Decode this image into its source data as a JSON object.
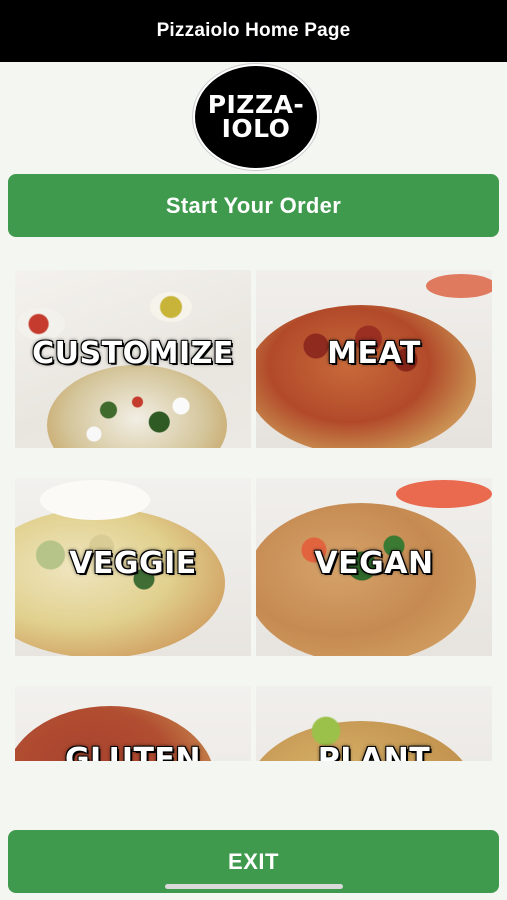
{
  "header": {
    "title": "Pizzaiolo Home Page"
  },
  "logo": {
    "line1": "PIZZA-",
    "line2": "IOLO"
  },
  "start_button": {
    "label": "Start Your Order"
  },
  "categories": [
    {
      "label": "CUSTOMIZE"
    },
    {
      "label": "MEAT"
    },
    {
      "label": "VEGGIE"
    },
    {
      "label": "VEGAN"
    },
    {
      "label": "GLUTEN"
    },
    {
      "label": "PLANT"
    }
  ],
  "exit_button": {
    "label": "EXIT"
  }
}
